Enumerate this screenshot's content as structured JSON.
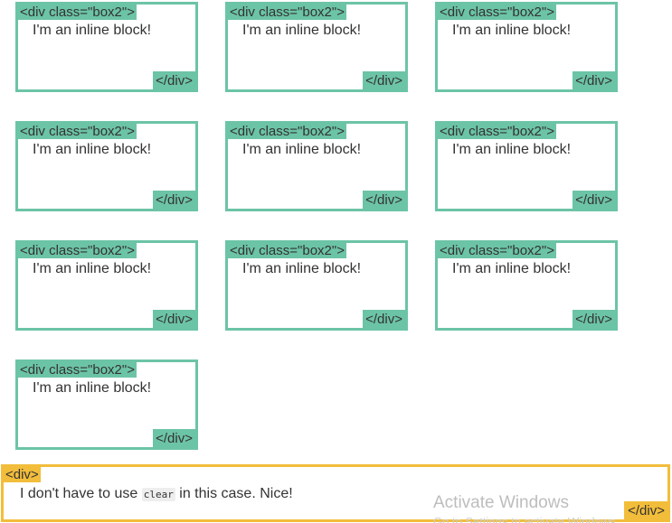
{
  "boxes": [
    {
      "open_tag": "<div class=\"box2\">",
      "text": "I'm an inline block!",
      "close_tag": "</div>"
    },
    {
      "open_tag": "<div class=\"box2\">",
      "text": "I'm an inline block!",
      "close_tag": "</div>"
    },
    {
      "open_tag": "<div class=\"box2\">",
      "text": "I'm an inline block!",
      "close_tag": "</div>"
    },
    {
      "open_tag": "<div class=\"box2\">",
      "text": "I'm an inline block!",
      "close_tag": "</div>"
    },
    {
      "open_tag": "<div class=\"box2\">",
      "text": "I'm an inline block!",
      "close_tag": "</div>"
    },
    {
      "open_tag": "<div class=\"box2\">",
      "text": "I'm an inline block!",
      "close_tag": "</div>"
    },
    {
      "open_tag": "<div class=\"box2\">",
      "text": "I'm an inline block!",
      "close_tag": "</div>"
    },
    {
      "open_tag": "<div class=\"box2\">",
      "text": "I'm an inline block!",
      "close_tag": "</div>"
    },
    {
      "open_tag": "<div class=\"box2\">",
      "text": "I'm an inline block!",
      "close_tag": "</div>"
    },
    {
      "open_tag": "<div class=\"box2\">",
      "text": "I'm an inline block!",
      "close_tag": "</div>"
    }
  ],
  "container": {
    "open_tag": "<div>",
    "text_before": "I don't have to use ",
    "code": "clear",
    "text_after": " in this case. Nice!",
    "close_tag": "</div>"
  },
  "watermark": {
    "title": "Activate Windows",
    "subtitle": "Go to Settings to activate Windows."
  },
  "colors": {
    "box_border": "#6cc4a6",
    "container_border": "#f2bd3a"
  }
}
